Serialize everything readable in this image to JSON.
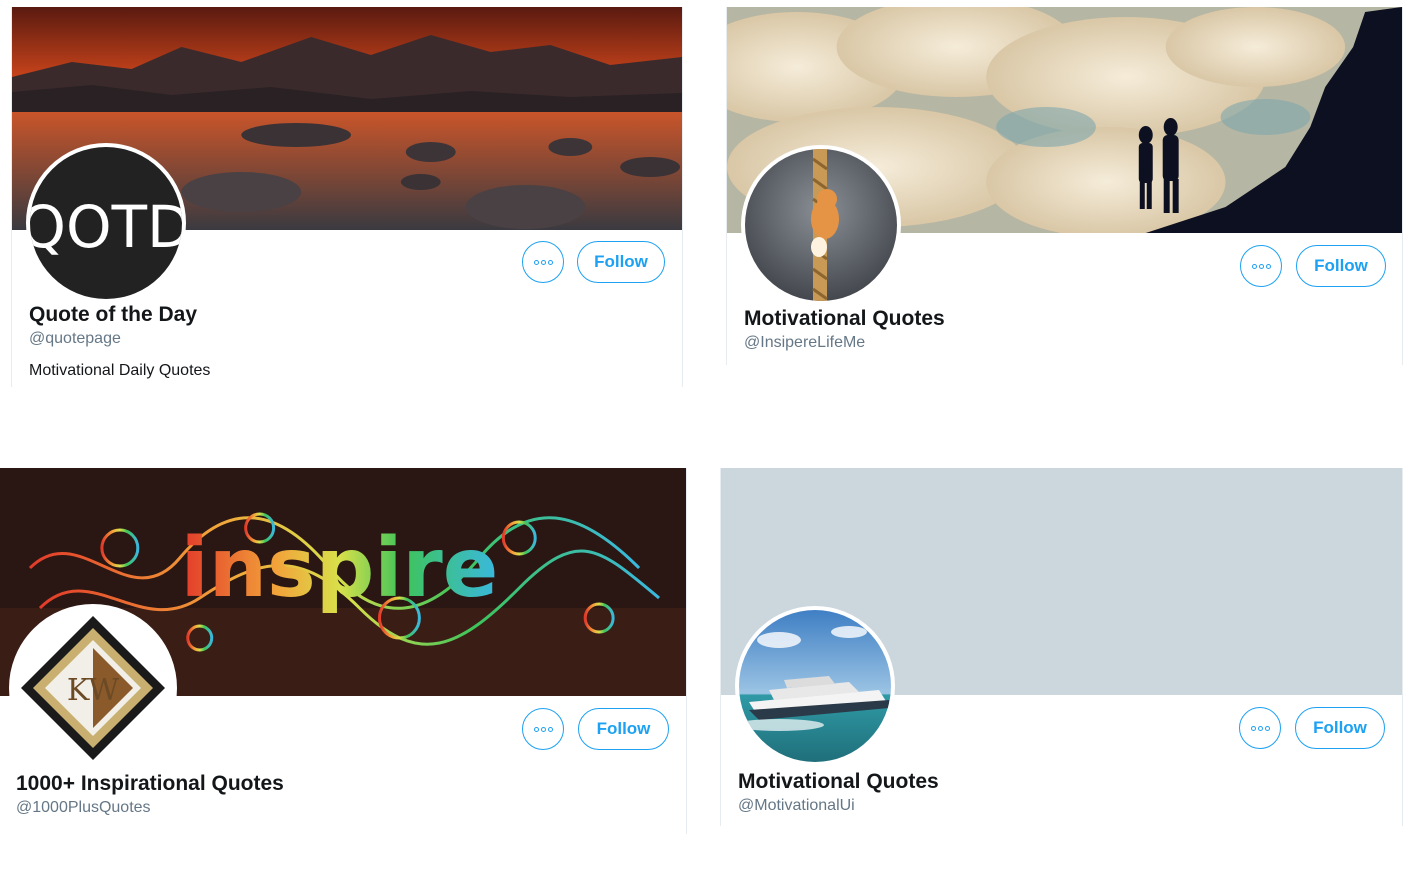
{
  "colors": {
    "accent": "#1da1f2",
    "muted": "#657786",
    "text": "#14171a",
    "placeholder_banner": "#ccd6dd"
  },
  "cards": [
    {
      "name": "Quote of the Day",
      "handle": "@quotepage",
      "bio": "Motivational Daily Quotes",
      "avatar_text": "QOTD",
      "follow_label": "Follow",
      "more_icon": "more-options-icon"
    },
    {
      "name": "Motivational Quotes",
      "handle": "@InsipereLifeMe",
      "follow_label": "Follow",
      "more_icon": "more-options-icon"
    },
    {
      "name": "1000+ Inspirational Quotes",
      "handle": "@1000PlusQuotes",
      "banner_text": "inspire",
      "avatar_text": "KW",
      "follow_label": "Follow",
      "more_icon": "more-options-icon"
    },
    {
      "name": "Motivational Quotes",
      "handle": "@MotivationalUi",
      "follow_label": "Follow",
      "more_icon": "more-options-icon"
    }
  ]
}
